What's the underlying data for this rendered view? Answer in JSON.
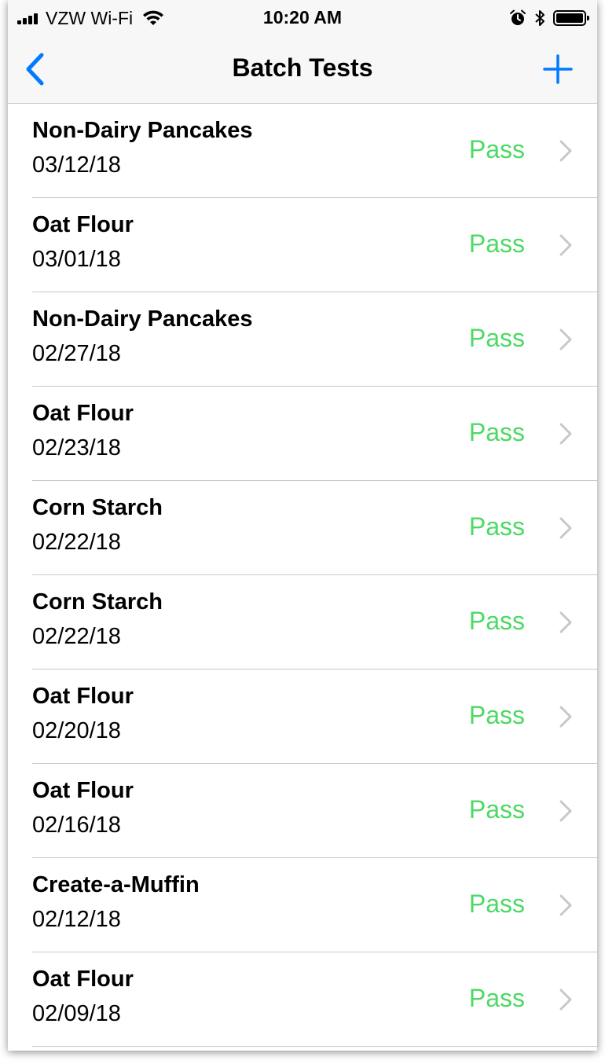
{
  "status_bar": {
    "carrier": "VZW Wi-Fi",
    "time": "10:20 AM",
    "icons": [
      "signal-icon",
      "wifi-icon",
      "alarm-icon",
      "bluetooth-icon",
      "battery-icon"
    ]
  },
  "nav": {
    "title": "Batch Tests",
    "back_icon": "chevron-left-icon",
    "add_icon": "plus-icon"
  },
  "colors": {
    "accent": "#007aff",
    "pass": "#4cd964",
    "separator": "#c8c7cc",
    "chevron": "#c7c7cc"
  },
  "tests": [
    {
      "name": "Non-Dairy Pancakes",
      "date": "03/12/18",
      "status": "Pass"
    },
    {
      "name": "Oat Flour",
      "date": "03/01/18",
      "status": "Pass"
    },
    {
      "name": "Non-Dairy Pancakes",
      "date": "02/27/18",
      "status": "Pass"
    },
    {
      "name": "Oat Flour",
      "date": "02/23/18",
      "status": "Pass"
    },
    {
      "name": "Corn Starch",
      "date": "02/22/18",
      "status": "Pass"
    },
    {
      "name": "Corn Starch",
      "date": "02/22/18",
      "status": "Pass"
    },
    {
      "name": "Oat Flour",
      "date": "02/20/18",
      "status": "Pass"
    },
    {
      "name": "Oat Flour",
      "date": "02/16/18",
      "status": "Pass"
    },
    {
      "name": "Create-a-Muffin",
      "date": "02/12/18",
      "status": "Pass"
    },
    {
      "name": "Oat Flour",
      "date": "02/09/18",
      "status": "Pass"
    }
  ]
}
